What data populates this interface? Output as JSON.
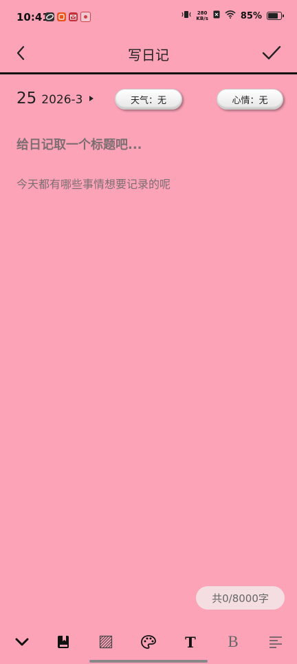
{
  "status_bar": {
    "time": "10:41",
    "net_speed_value": "280",
    "net_speed_unit": "KB/s",
    "battery": "85%",
    "battery_level": 0.85,
    "left_icons": [
      "app-notification-icon",
      "orange-app-icon",
      "mail-icon",
      "photo-app-icon"
    ],
    "right_icons": [
      "vibrate-icon",
      "no-sim-icon",
      "wifi-icon",
      "battery-icon"
    ]
  },
  "header": {
    "title": "写日记",
    "back_icon": "chevron-left-icon",
    "confirm_icon": "check-icon"
  },
  "entry": {
    "day": "25",
    "year_month": "2026-3",
    "weather_label": "天气：无",
    "mood_label": "心情：无",
    "title_placeholder": "给日记取一个标题吧...",
    "content_placeholder": "今天都有哪些事情想要记录的呢"
  },
  "counter": {
    "text": "共0/8000字"
  },
  "toolbar": {
    "items": [
      {
        "icon": "chevron-down-icon"
      },
      {
        "icon": "bookmark-book-icon"
      },
      {
        "icon": "texture-pattern-icon"
      },
      {
        "icon": "palette-icon"
      },
      {
        "icon": "text-font-icon",
        "glyph": "T"
      },
      {
        "icon": "bold-icon",
        "glyph": "B"
      },
      {
        "icon": "align-icon"
      }
    ]
  },
  "colors": {
    "background": "#fca3b8",
    "placeholder": "#7d6e72",
    "divider": "#111111",
    "counter_bg": "#f4dee1"
  }
}
